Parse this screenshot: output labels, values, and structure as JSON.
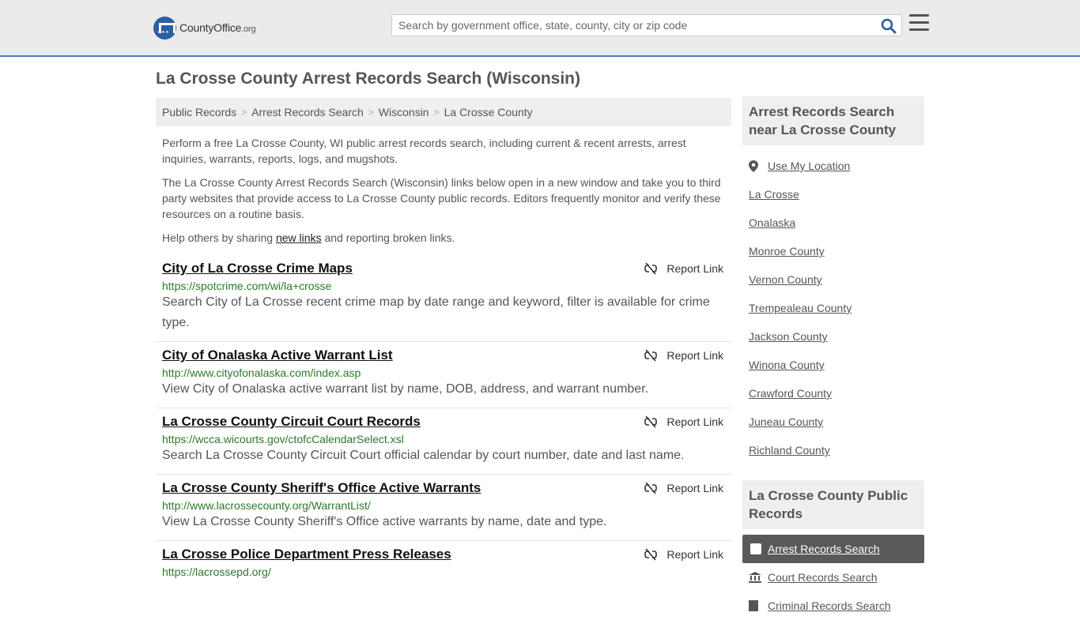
{
  "header": {
    "logo_name": "CountyOffice",
    "logo_suffix": ".org",
    "search_placeholder": "Search by government office, state, county, city or zip code"
  },
  "page_title": "La Crosse County Arrest Records Search (Wisconsin)",
  "breadcrumb": [
    "Public Records",
    "Arrest Records Search",
    "Wisconsin",
    "La Crosse County"
  ],
  "intro": {
    "p1": "Perform a free La Crosse County, WI public arrest records search, including current & recent arrests, arrest inquiries, warrants, reports, logs, and mugshots.",
    "p2": "The La Crosse County Arrest Records Search (Wisconsin) links below open in a new window and take you to third party websites that provide access to La Crosse County public records. Editors frequently monitor and verify these resources on a routine basis.",
    "p3_before": "Help others by sharing ",
    "p3_link": "new links",
    "p3_after": " and reporting broken links."
  },
  "report_label": "Report Link",
  "results": [
    {
      "title": "City of La Crosse Crime Maps",
      "url": "https://spotcrime.com/wi/la+crosse",
      "desc": "Search City of La Crosse recent crime map by date range and keyword, filter is available for crime type."
    },
    {
      "title": "City of Onalaska Active Warrant List",
      "url": "http://www.cityofonalaska.com/index.asp",
      "desc": "View City of Onalaska active warrant list by name, DOB, address, and warrant number."
    },
    {
      "title": "La Crosse County Circuit Court Records",
      "url": "https://wcca.wicourts.gov/ctofcCalendarSelect.xsl",
      "desc": "Search La Crosse County Circuit Court official calendar by court number, date and last name."
    },
    {
      "title": "La Crosse County Sheriff's Office Active Warrants",
      "url": "http://www.lacrossecounty.org/WarrantList/",
      "desc": "View La Crosse County Sheriff's Office active warrants by name, date and type."
    },
    {
      "title": "La Crosse Police Department Press Releases",
      "url": "https://lacrossepd.org/",
      "desc": ""
    }
  ],
  "sidebar": {
    "near_heading": "Arrest Records Search near La Crosse County",
    "use_location": "Use My Location",
    "near_links": [
      "La Crosse",
      "Onalaska",
      "Monroe County",
      "Vernon County",
      "Trempealeau County",
      "Jackson County",
      "Winona County",
      "Crawford County",
      "Juneau County",
      "Richland County"
    ],
    "public_heading": "La Crosse County Public Records",
    "public_active": "Arrest Records Search",
    "public_links": [
      "Court Records Search",
      "Criminal Records Search"
    ]
  },
  "icons": {
    "logo": "capitol-seal-icon",
    "search": "search-icon",
    "menu": "hamburger-menu-icon",
    "report": "broken-link-icon",
    "location": "map-pin-icon",
    "court": "courthouse-icon",
    "checkbox": "square-icon"
  },
  "colors": {
    "header_bg": "#ebebeb",
    "accent_blue": "#2b5fa3",
    "url_green": "#2a7a2a",
    "active_bg": "#595959"
  }
}
